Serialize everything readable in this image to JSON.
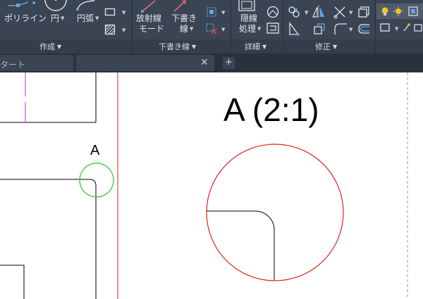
{
  "ribbon": {
    "panels": {
      "create": "作成",
      "draft": "下書き線",
      "detail": "詳細",
      "modify": "修正"
    },
    "buttons": {
      "polyline": "ポリライン",
      "circle": "円",
      "arc": "円弧",
      "radial_mode_1": "放射線",
      "radial_mode_2": "モード",
      "draft_line_1": "下書き",
      "draft_line_2": "線",
      "hidden_1": "隠線",
      "hidden_2": "処理"
    }
  },
  "tabs": {
    "start_tab": "タート",
    "close_symbol": "✕",
    "add_symbol": "+"
  },
  "drawing": {
    "label_a": "A",
    "detail_title": "A (2:1)"
  },
  "colors": {
    "ribbon_bg": "#3b4453",
    "tabbar_bg": "#2b313c",
    "detail_circle": "#e02020",
    "callout_circle": "#22cc22",
    "magenta_line": "#e020e0",
    "red_vertical": "#e02020"
  }
}
